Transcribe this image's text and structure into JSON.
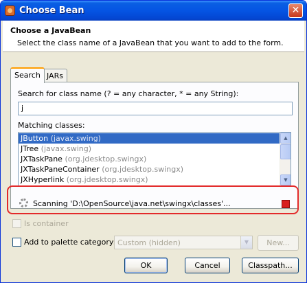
{
  "window": {
    "title": "Choose Bean"
  },
  "header": {
    "title": "Choose a JavaBean",
    "description": "Select the class name of a JavaBean that you want to add to the form."
  },
  "tabs": [
    {
      "label": "Search",
      "active": true
    },
    {
      "label": "JARs",
      "active": false
    }
  ],
  "search": {
    "label": "Search for class name (? = any character, * = any String):",
    "value": "j"
  },
  "matching": {
    "label": "Matching classes:",
    "items": [
      {
        "name": "JButton",
        "pkg": "(javax.swing)",
        "selected": true
      },
      {
        "name": "JTree",
        "pkg": "(javax.swing)",
        "selected": false
      },
      {
        "name": "JXTaskPane",
        "pkg": "(org.jdesktop.swingx)",
        "selected": false
      },
      {
        "name": "JXTaskPaneContainer",
        "pkg": "(org.jdesktop.swingx)",
        "selected": false
      },
      {
        "name": "JXHyperlink",
        "pkg": "(org.jdesktop.swingx)",
        "selected": false
      }
    ]
  },
  "status": {
    "text": "Scanning 'D:\\OpenSource\\java.net\\swingx\\classes'..."
  },
  "options": {
    "is_container": "Is container",
    "add_to_palette": "Add to palette category:",
    "category_value": "Custom (hidden)",
    "new_button": "New..."
  },
  "buttons": {
    "ok": "OK",
    "cancel": "Cancel",
    "classpath": "Classpath..."
  },
  "colors": {
    "highlight": "#e32a2a",
    "selection": "#316ac5",
    "titlebar": "#0554e3"
  }
}
